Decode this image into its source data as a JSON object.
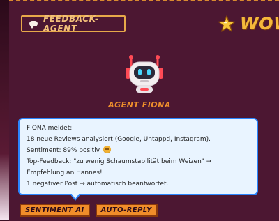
{
  "header": {
    "chip_label": "FEEDBACK-AGENT",
    "wow_label": "WOW!"
  },
  "agent": {
    "name": "AGENT FIONA"
  },
  "message": {
    "line1": "FIONA meldet:",
    "line2": "18 neue Reviews analysiert (Google, Untappd, Instagram).",
    "line3": "Sentiment: 89% positiv",
    "line4": "Top-Feedback: \"zu wenig Schaumstabilität beim Weizen\" →",
    "line5": "Empfehlung an Hannes!",
    "line6": "1 negativer Post → automatisch beantwortet."
  },
  "tags": {
    "tag1": "SENTIMENT AI",
    "tag2": "AUTO-REPLY"
  },
  "icons": {
    "chat": "chat-bubble-icon",
    "star": "star-icon",
    "robot": "robot-icon",
    "emoji": "smiling-face-icon"
  },
  "colors": {
    "background": "#4c1732",
    "accent_orange": "#f08d2a",
    "bubble_border": "#2a86ff",
    "bubble_bg": "#e9f4ff"
  }
}
